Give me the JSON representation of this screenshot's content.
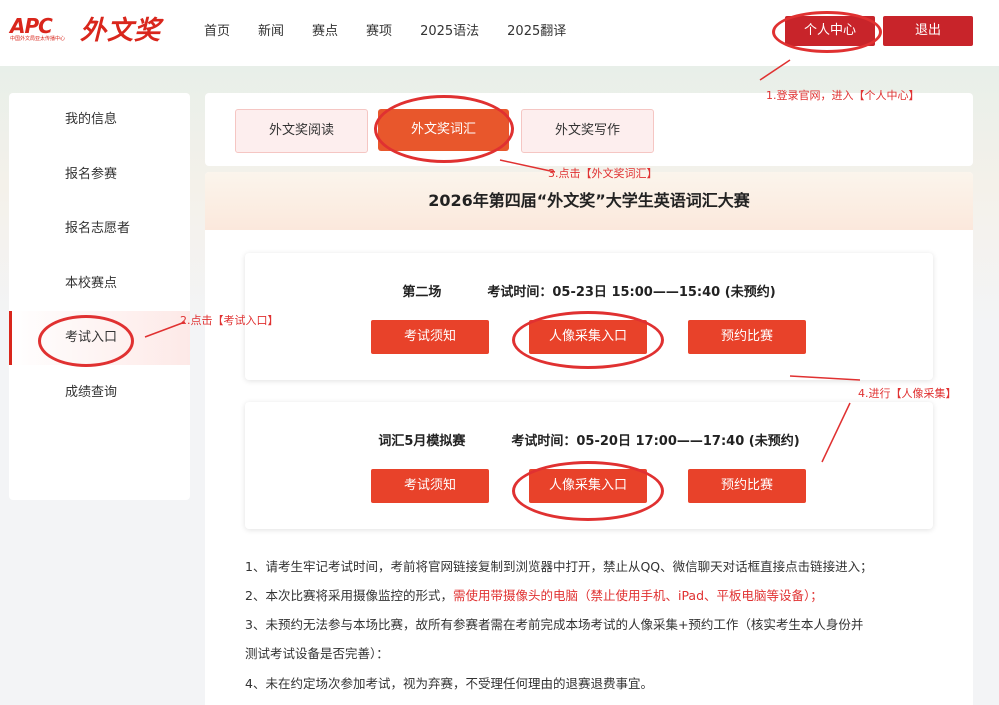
{
  "header": {
    "logo_apc": "APC",
    "logo_apc_sub": "中国外文局亚太传播中心",
    "logo_cn": "外文奖",
    "nav": [
      "首页",
      "新闻",
      "赛点",
      "赛项",
      "2025语法",
      "2025翻译"
    ],
    "personal_center": "个人中心",
    "logout": "退出"
  },
  "sidebar": {
    "items": [
      "我的信息",
      "报名参赛",
      "报名志愿者",
      "本校赛点",
      "考试入口",
      "成绩查询"
    ],
    "active_index": 4
  },
  "tabs": [
    "外文奖阅读",
    "外文奖词汇",
    "外文奖写作"
  ],
  "active_tab": 1,
  "main": {
    "title": "2026年第四届“外文奖”大学生英语词汇大赛",
    "sessions": [
      {
        "name": "第二场",
        "time": "考试时间：05-23日 15:00——15:40 (未预约)",
        "buttons": [
          "考试须知",
          "人像采集入口",
          "预约比赛"
        ]
      },
      {
        "name": "词汇5月模拟赛",
        "time": "考试时间：05-20日 17:00——17:40 (未预约)",
        "buttons": [
          "考试须知",
          "人像采集入口",
          "预约比赛"
        ]
      }
    ],
    "notes": {
      "n1": "1、请考生牢记考试时间，考前将官网链接复制到浏览器中打开，禁止从QQ、微信聊天对话框直接点击链接进入；",
      "n2_prefix": "2、本次比赛将采用摄像监控的形式，",
      "n2_red": "需使用带摄像头的电脑（禁止使用手机、iPad、平板电脑等设备）；",
      "n3a": "3、未预约无法参与本场比赛，故所有参赛者需在考前完成本场考试的人像采集+预约工作（核实考生本人身份并",
      "n3b": "测试考试设备是否完善）：",
      "n4": "4、未在约定场次参加考试，视为弃赛，不受理任何理由的退赛退费事宜。"
    }
  },
  "annotations": {
    "step1": "1.登录官网，进入【个人中心】",
    "step2": "2.点击【考试入口】",
    "step3": "3.点击【外文奖词汇】",
    "step4": "4.进行【人像采集】"
  },
  "colors": {
    "brand_red": "#c8242a",
    "annotation_red": "#e03131",
    "button_orange": "#e8422a",
    "active_tab": "#e8572c"
  }
}
